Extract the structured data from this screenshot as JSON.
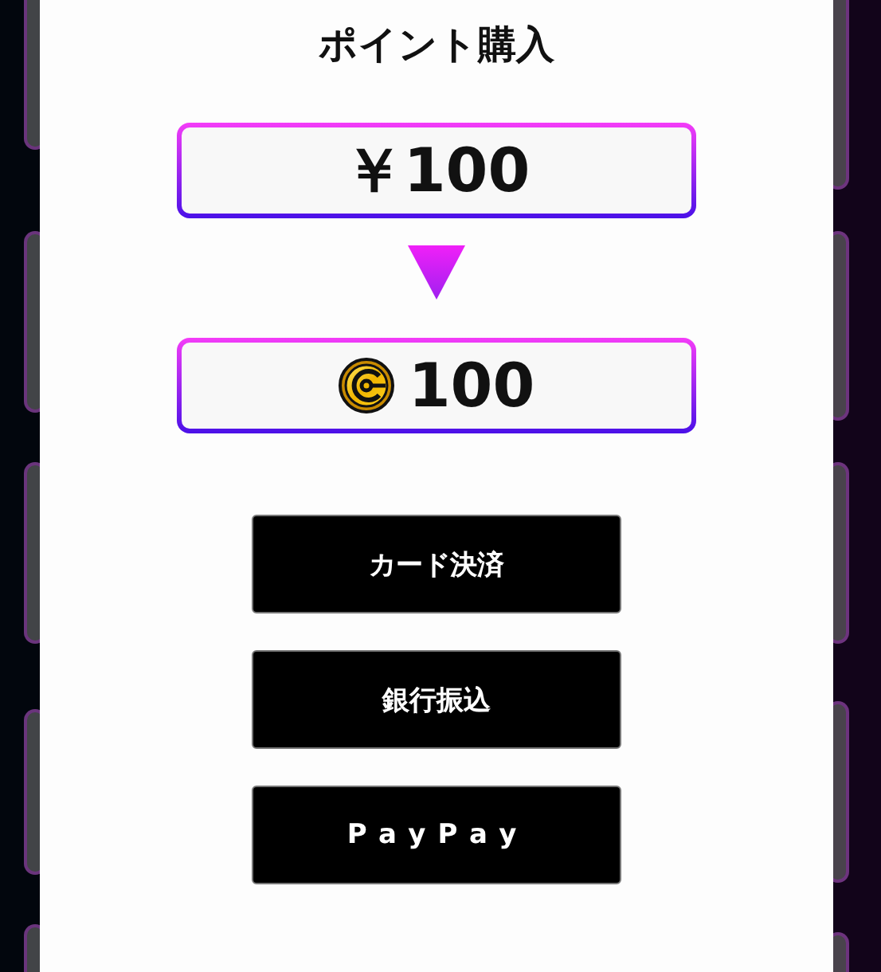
{
  "dialog": {
    "title": "ポイント購入",
    "price": "￥100",
    "points": "100",
    "payment_buttons": [
      "カード決済",
      "銀行振込",
      "PayPay"
    ]
  }
}
